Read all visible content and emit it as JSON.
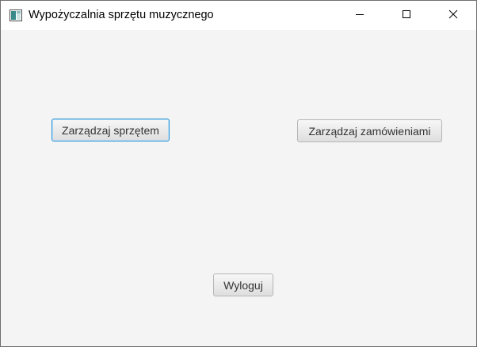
{
  "window": {
    "title": "Wypożyczalnia sprzętu muzycznego",
    "icon": "app-window-icon",
    "controls": [
      "minimize-icon",
      "maximize-icon",
      "close-icon"
    ]
  },
  "main": {
    "manage_equipment_label": "Zarządzaj sprzętem",
    "manage_orders_label": "Zarządzaj zamówieniami",
    "logout_label": "Wyloguj",
    "focused_button": "manage-equipment-button"
  },
  "colors": {
    "background": "#f4f4f4",
    "titlebar": "#ffffff",
    "focus_border": "#2b93d6",
    "button_border": "#b5b5b5"
  }
}
